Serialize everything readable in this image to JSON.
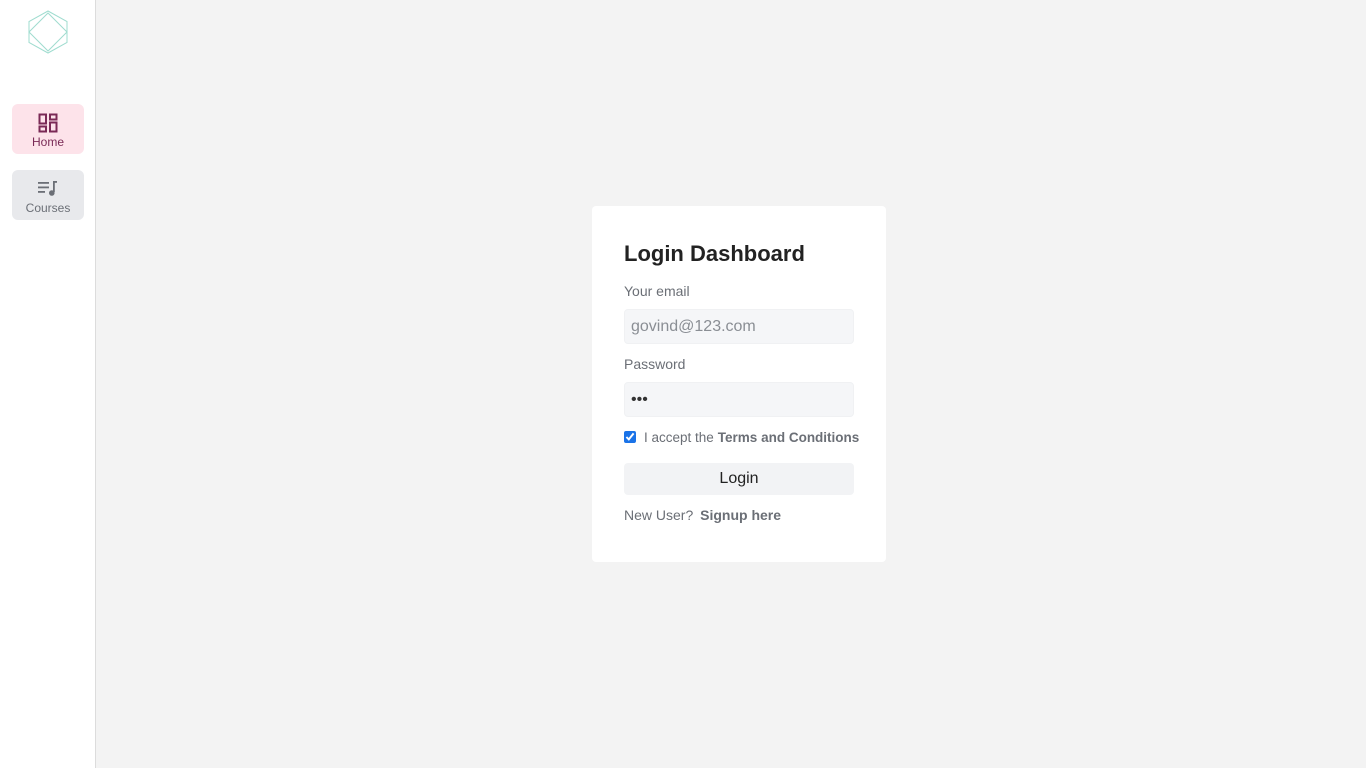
{
  "sidebar": {
    "logo_icon": "hexagon-logo-icon",
    "items": [
      {
        "label": "Home",
        "icon": "dashboard-grid-icon",
        "active": true,
        "color": "#7a2a56",
        "bg": "#fde3ea"
      },
      {
        "label": "Courses",
        "icon": "playlist-music-icon",
        "active": false,
        "color": "#6b6f76",
        "bg": "#e8e9ec"
      }
    ]
  },
  "login": {
    "title": "Login Dashboard",
    "email_label": "Your email",
    "email_placeholder": "govind@123.com",
    "email_value": "",
    "password_label": "Password",
    "password_value": "•••",
    "terms_prefix": "I accept the",
    "terms_link": "Terms and Conditions",
    "terms_checked": true,
    "login_button": "Login",
    "signup_prefix": "New User?",
    "signup_link": "Signup here"
  },
  "colors": {
    "page_bg": "#f3f3f3",
    "accent_home": "#7a2a56",
    "logo": "#9fdccf",
    "checkbox": "#1a73e8"
  }
}
